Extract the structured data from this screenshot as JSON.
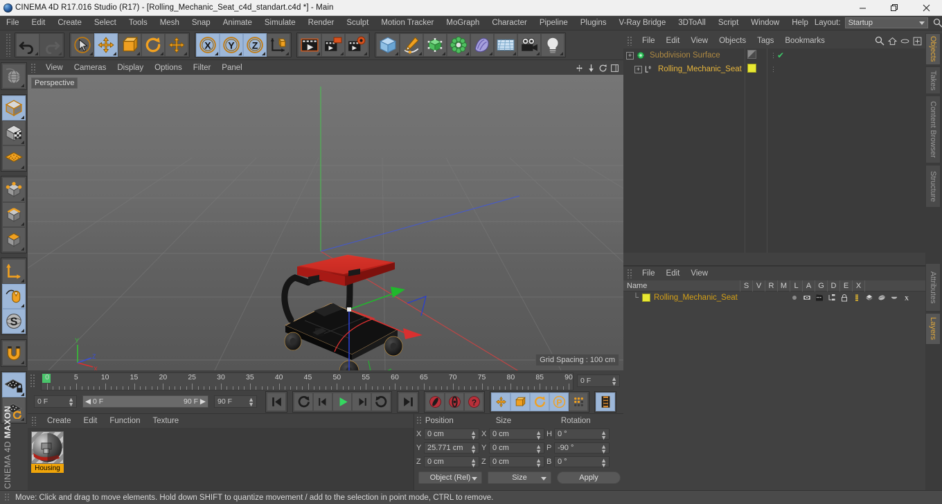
{
  "window": {
    "title": "CINEMA 4D R17.016 Studio (R17) - [Rolling_Mechanic_Seat_c4d_standart.c4d *] - Main",
    "minimize": "minimize-button",
    "maximize": "restore-button",
    "close": "close-button"
  },
  "menubar": {
    "items": [
      "File",
      "Edit",
      "Create",
      "Select",
      "Tools",
      "Mesh",
      "Snap",
      "Animate",
      "Simulate",
      "Render",
      "Sculpt",
      "Motion Tracker",
      "MoGraph",
      "Character",
      "Pipeline",
      "Plugins",
      "V-Ray Bridge",
      "3DToAll",
      "Script",
      "Window",
      "Help"
    ],
    "layout_label": "Layout:",
    "layout_value": "Startup"
  },
  "toolbar": {
    "groups": [
      {
        "name": "undo-redo",
        "buttons": [
          {
            "icon": "undo-icon",
            "label": "Undo",
            "selected": false,
            "dim": false
          },
          {
            "icon": "redo-icon",
            "label": "Redo",
            "selected": false,
            "dim": true
          }
        ]
      },
      {
        "name": "transform-tools",
        "buttons": [
          {
            "icon": "select-cursor-icon",
            "label": "Live Selection",
            "selected": false,
            "dim": false
          },
          {
            "icon": "move-icon",
            "label": "Move",
            "selected": true,
            "dim": false
          },
          {
            "icon": "scale-icon",
            "label": "Scale",
            "selected": false,
            "dim": false
          },
          {
            "icon": "rotate-icon",
            "label": "Rotate",
            "selected": false,
            "dim": false
          },
          {
            "icon": "move-alt-icon",
            "label": "Move Tool Options",
            "selected": false,
            "dim": false
          }
        ]
      },
      {
        "name": "axis-locks",
        "buttons": [
          {
            "icon": "axis-x-icon",
            "label": "X Axis",
            "selected": true,
            "dim": false
          },
          {
            "icon": "axis-y-icon",
            "label": "Y Axis",
            "selected": true,
            "dim": false
          },
          {
            "icon": "axis-z-icon",
            "label": "Z Axis",
            "selected": true,
            "dim": false
          },
          {
            "icon": "world-coordinates-icon",
            "label": "World / Object Coordinate System",
            "selected": false,
            "dim": false
          }
        ]
      },
      {
        "name": "render-tools",
        "buttons": [
          {
            "icon": "render-view-icon",
            "label": "Render View",
            "selected": false,
            "dim": false
          },
          {
            "icon": "render-picture-viewer-icon",
            "label": "Render to Picture Viewer",
            "selected": false,
            "dim": false
          },
          {
            "icon": "render-settings-icon",
            "label": "Edit Render Settings",
            "selected": false,
            "dim": false
          }
        ]
      },
      {
        "name": "create-objects",
        "buttons": [
          {
            "icon": "cube-primitive-icon",
            "label": "Add Cube Object",
            "selected": false,
            "dim": false
          },
          {
            "icon": "spline-pen-icon",
            "label": "Add Spline Object",
            "selected": false,
            "dim": false
          },
          {
            "icon": "generator-nurbs-icon",
            "label": "Add Generator Object",
            "selected": false,
            "dim": false
          },
          {
            "icon": "deformer-icon",
            "label": "Add Deformer Object",
            "selected": false,
            "dim": false
          },
          {
            "icon": "environment-icon",
            "label": "Add Environment Object",
            "selected": false,
            "dim": false
          },
          {
            "icon": "scene-floor-icon",
            "label": "Add Scene Object",
            "selected": false,
            "dim": false
          },
          {
            "icon": "camera-icon",
            "label": "Add Camera Object",
            "selected": false,
            "dim": false
          },
          {
            "icon": "light-bulb-icon",
            "label": "Add Light Object",
            "selected": false,
            "dim": false
          }
        ]
      }
    ]
  },
  "lefttoolbar": {
    "groups": [
      {
        "name": "viewport-group",
        "buttons": [
          {
            "icon": "globe-wire-icon",
            "label": "Make Editable / Viewport",
            "selected": false
          }
        ]
      },
      {
        "name": "mode-group-1",
        "buttons": [
          {
            "icon": "model-mode-icon",
            "label": "Model Mode",
            "selected": true
          },
          {
            "icon": "texture-mode-icon",
            "label": "Texture Mode",
            "selected": false
          },
          {
            "icon": "workplane-mode-icon",
            "label": "Workplane Mode",
            "selected": false
          }
        ]
      },
      {
        "name": "component-group",
        "buttons": [
          {
            "icon": "points-mode-icon",
            "label": "Points Mode",
            "selected": false
          },
          {
            "icon": "edges-mode-icon",
            "label": "Edges Mode",
            "selected": false
          },
          {
            "icon": "polygons-mode-icon",
            "label": "Polygons Mode",
            "selected": false
          }
        ]
      },
      {
        "name": "axis-group",
        "buttons": [
          {
            "icon": "enable-axis-icon",
            "label": "Enable Axis Modification",
            "selected": false
          },
          {
            "icon": "viewport-solo-icon",
            "label": "Enable Viewport Solo",
            "selected": true
          },
          {
            "icon": "soft-selection-icon",
            "label": "Soft Selection",
            "selected": true
          }
        ]
      },
      {
        "name": "snap-group",
        "buttons": [
          {
            "icon": "magnet-snap-icon",
            "label": "Enable Snapping",
            "selected": false
          }
        ]
      },
      {
        "name": "grid-group",
        "buttons": [
          {
            "icon": "lock-workplane-icon",
            "label": "Lock Workplane",
            "selected": true
          },
          {
            "icon": "planar-workplane-icon",
            "label": "Workplane Mode",
            "selected": false
          }
        ]
      }
    ],
    "brand_prefix": "MAXON",
    "brand_suffix": "CINEMA 4D"
  },
  "viewport": {
    "menu": [
      "View",
      "Cameras",
      "Display",
      "Options",
      "Filter",
      "Panel"
    ],
    "perspective_label": "Perspective",
    "grid_spacing": "Grid Spacing : 100 cm",
    "axis_x": "X",
    "axis_y": "Y",
    "axis_z": "Z",
    "corner_icons": [
      "viewport-pan-icon",
      "viewport-move-icon",
      "viewport-rotate-icon",
      "viewport-maximize-icon"
    ]
  },
  "timeline": {
    "ticks": [
      0,
      5,
      10,
      15,
      20,
      25,
      30,
      35,
      40,
      45,
      50,
      55,
      60,
      65,
      70,
      75,
      80,
      85,
      90
    ],
    "current_frame_right": "0 F",
    "current_frame": "0 F",
    "range_start": "0 F",
    "range_end": "90 F",
    "max_frame": "90 F",
    "transport": [
      {
        "icon": "go-to-start-icon",
        "label": "Go to Start"
      },
      {
        "icon": "previous-key-icon",
        "label": "Go to Previous Key"
      },
      {
        "icon": "step-back-icon",
        "label": "Go to Previous Frame"
      },
      {
        "icon": "play-icon",
        "label": "Play Forwards"
      },
      {
        "icon": "step-forward-icon",
        "label": "Go to Next Frame"
      },
      {
        "icon": "next-key-icon",
        "label": "Go to Next Key"
      },
      {
        "icon": "go-to-end-icon",
        "label": "Go to End"
      }
    ],
    "record": [
      {
        "icon": "record-active-objects-icon",
        "label": "Record Active Objects"
      },
      {
        "icon": "autokeying-icon",
        "label": "Autokeying"
      },
      {
        "icon": "keyframe-selection-icon",
        "label": "Keyframe Selection"
      }
    ],
    "keyflags": [
      {
        "icon": "key-position-icon",
        "label": "Position",
        "selected": true
      },
      {
        "icon": "key-scale-icon",
        "label": "Scale",
        "selected": true
      },
      {
        "icon": "key-rotation-icon",
        "label": "Rotation",
        "selected": true
      },
      {
        "icon": "key-parameter-icon",
        "label": "Parameter",
        "selected": true
      },
      {
        "icon": "key-pla-icon",
        "label": "Point Level Animation",
        "selected": false
      }
    ],
    "extra": [
      {
        "icon": "timeline-filmstrip-icon",
        "label": "Animation Layers"
      }
    ]
  },
  "material_manager": {
    "menu": [
      "Create",
      "Edit",
      "Function",
      "Texture"
    ],
    "materials": [
      {
        "name": "Housing",
        "thumb": "material-sphere-preview"
      }
    ]
  },
  "coordinates": {
    "headers": [
      "Position",
      "Size",
      "Rotation"
    ],
    "position": {
      "labels": [
        "X",
        "Y",
        "Z"
      ],
      "values": [
        "0 cm",
        "25.771 cm",
        "0 cm"
      ]
    },
    "size": {
      "labels": [
        "X",
        "Y",
        "Z"
      ],
      "values": [
        "0 cm",
        "0 cm",
        "0 cm"
      ]
    },
    "rotation": {
      "labels": [
        "H",
        "P",
        "B"
      ],
      "values": [
        "0 °",
        "-90 °",
        "0 °"
      ]
    },
    "mode_left": "Object (Rel)",
    "mode_mid": "Size",
    "apply": "Apply"
  },
  "object_manager": {
    "menu": [
      "File",
      "Edit",
      "View",
      "Objects",
      "Tags",
      "Bookmarks"
    ],
    "icons": [
      "search-icon",
      "home-icon",
      "ellipse-icon",
      "new-window-icon"
    ],
    "rows": [
      {
        "name": "Subdivision Surface",
        "type": "subdivision-surface-icon",
        "indent": 0,
        "color": "#b08a42",
        "tag_color": "diagonal",
        "check": true
      },
      {
        "name": "Rolling_Mechanic_Seat",
        "type": "null-object-icon",
        "indent": 1,
        "color": "#e8b63c",
        "tag_color": "#e8e832",
        "check": false
      }
    ]
  },
  "attributes_panel": {
    "menu": [
      "File",
      "Edit",
      "View"
    ],
    "name_header": "Name",
    "columns": [
      "S",
      "V",
      "R",
      "M",
      "L",
      "A",
      "G",
      "D",
      "E",
      "X"
    ],
    "rows": [
      {
        "name": "Rolling_Mechanic_Seat",
        "swatch": "#e8e832"
      }
    ]
  },
  "vertical_tabs": {
    "top": [
      {
        "label": "Objects",
        "active": true
      },
      {
        "label": "Takes",
        "active": false
      },
      {
        "label": "Content Browser",
        "active": false
      },
      {
        "label": "Structure",
        "active": false
      }
    ],
    "bottom": [
      {
        "label": "Attributes",
        "active": false
      },
      {
        "label": "Layers",
        "active": true
      }
    ]
  },
  "statusbar": {
    "message": "Move: Click and drag to move elements. Hold down SHIFT to quantize movement / add to the selection in point mode, CTRL to remove."
  },
  "colors": {
    "panel_bg": "#414141",
    "dark_bg": "#3b3b3b",
    "selection_blue": "#9db7d8",
    "accent_orange": "#e8a33d",
    "axis_x": "#d94141",
    "axis_y": "#49c44f",
    "axis_z": "#4158d9",
    "seat_red": "#c4231e",
    "highlight_yellow": "#f0a50a"
  }
}
